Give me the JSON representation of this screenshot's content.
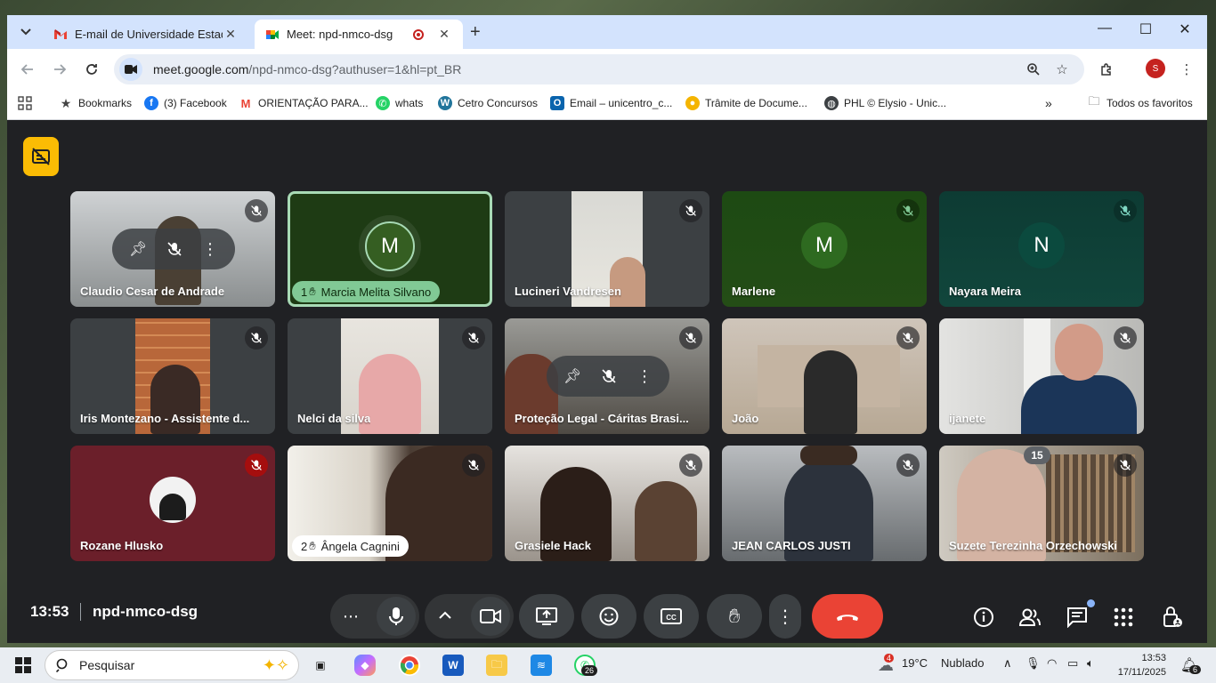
{
  "browser": {
    "tabs": [
      {
        "title": "E-mail de Universidade Estadual"
      },
      {
        "title": "Meet: npd-nmco-dsg"
      }
    ],
    "url_main": "meet.google.com",
    "url_rest": "/npd-nmco-dsg?authuser=1&hl=pt_BR",
    "profile_initial": "S",
    "bookmarks": [
      {
        "label": "Bookmarks",
        "icon": "star-icon"
      },
      {
        "label": "(3) Facebook",
        "icon": "facebook-icon"
      },
      {
        "label": "ORIENTAÇÃO PARA...",
        "icon": "gmail-icon"
      },
      {
        "label": "whats",
        "icon": "whatsapp-icon"
      },
      {
        "label": "Cetro Concursos",
        "icon": "wordpress-icon"
      },
      {
        "label": "Email – unicentro_c...",
        "icon": "outlook-icon"
      },
      {
        "label": "Trâmite de Docume...",
        "icon": "group-icon"
      },
      {
        "label": "PHL © Elysio - Unic...",
        "icon": "globe-icon"
      }
    ],
    "all_bookmarks": "Todos os favoritos"
  },
  "meet": {
    "participants": [
      {
        "name": "Claudio Cesar de Andrade",
        "type": "video"
      },
      {
        "name": "Marcia Melita Silvano",
        "type": "avatar",
        "initial": "M",
        "hand": "1",
        "speaking": true
      },
      {
        "name": "Lucineri Vandresen",
        "type": "video"
      },
      {
        "name": "Marlene",
        "type": "avatar",
        "initial": "M"
      },
      {
        "name": "Nayara Meira",
        "type": "avatar",
        "initial": "N"
      },
      {
        "name": "Iris Montezano - Assistente d...",
        "type": "video"
      },
      {
        "name": "Nelci da silva",
        "type": "video"
      },
      {
        "name": "Proteção Legal - Cáritas Brasi...",
        "type": "video"
      },
      {
        "name": "João",
        "type": "video"
      },
      {
        "name": "ijanete",
        "type": "video"
      },
      {
        "name": "Rozane Hlusko",
        "type": "photo-avatar"
      },
      {
        "name": "Ângela Cagnini",
        "type": "video",
        "hand": "2"
      },
      {
        "name": "Grasiele Hack",
        "type": "video"
      },
      {
        "name": "JEAN CARLOS JUSTI",
        "type": "video"
      },
      {
        "name": "Suzete Terezinha Orzechowski",
        "type": "video"
      }
    ],
    "time": "13:53",
    "meeting_code": "npd-nmco-dsg",
    "participant_count": "15"
  },
  "taskbar": {
    "search_placeholder": "Pesquisar",
    "weather_temp": "19°C",
    "weather_text": "Nublado",
    "weather_badge": "4",
    "whatsapp_badge": "26",
    "clock_time": "13:53",
    "clock_date": "17/11/2025",
    "notif_count": "6"
  },
  "colors": {
    "meet_bg": "#202124",
    "end_call": "#ea4335",
    "tab_strip": "#d3e3fd",
    "speaking_border": "#a8dab5"
  }
}
